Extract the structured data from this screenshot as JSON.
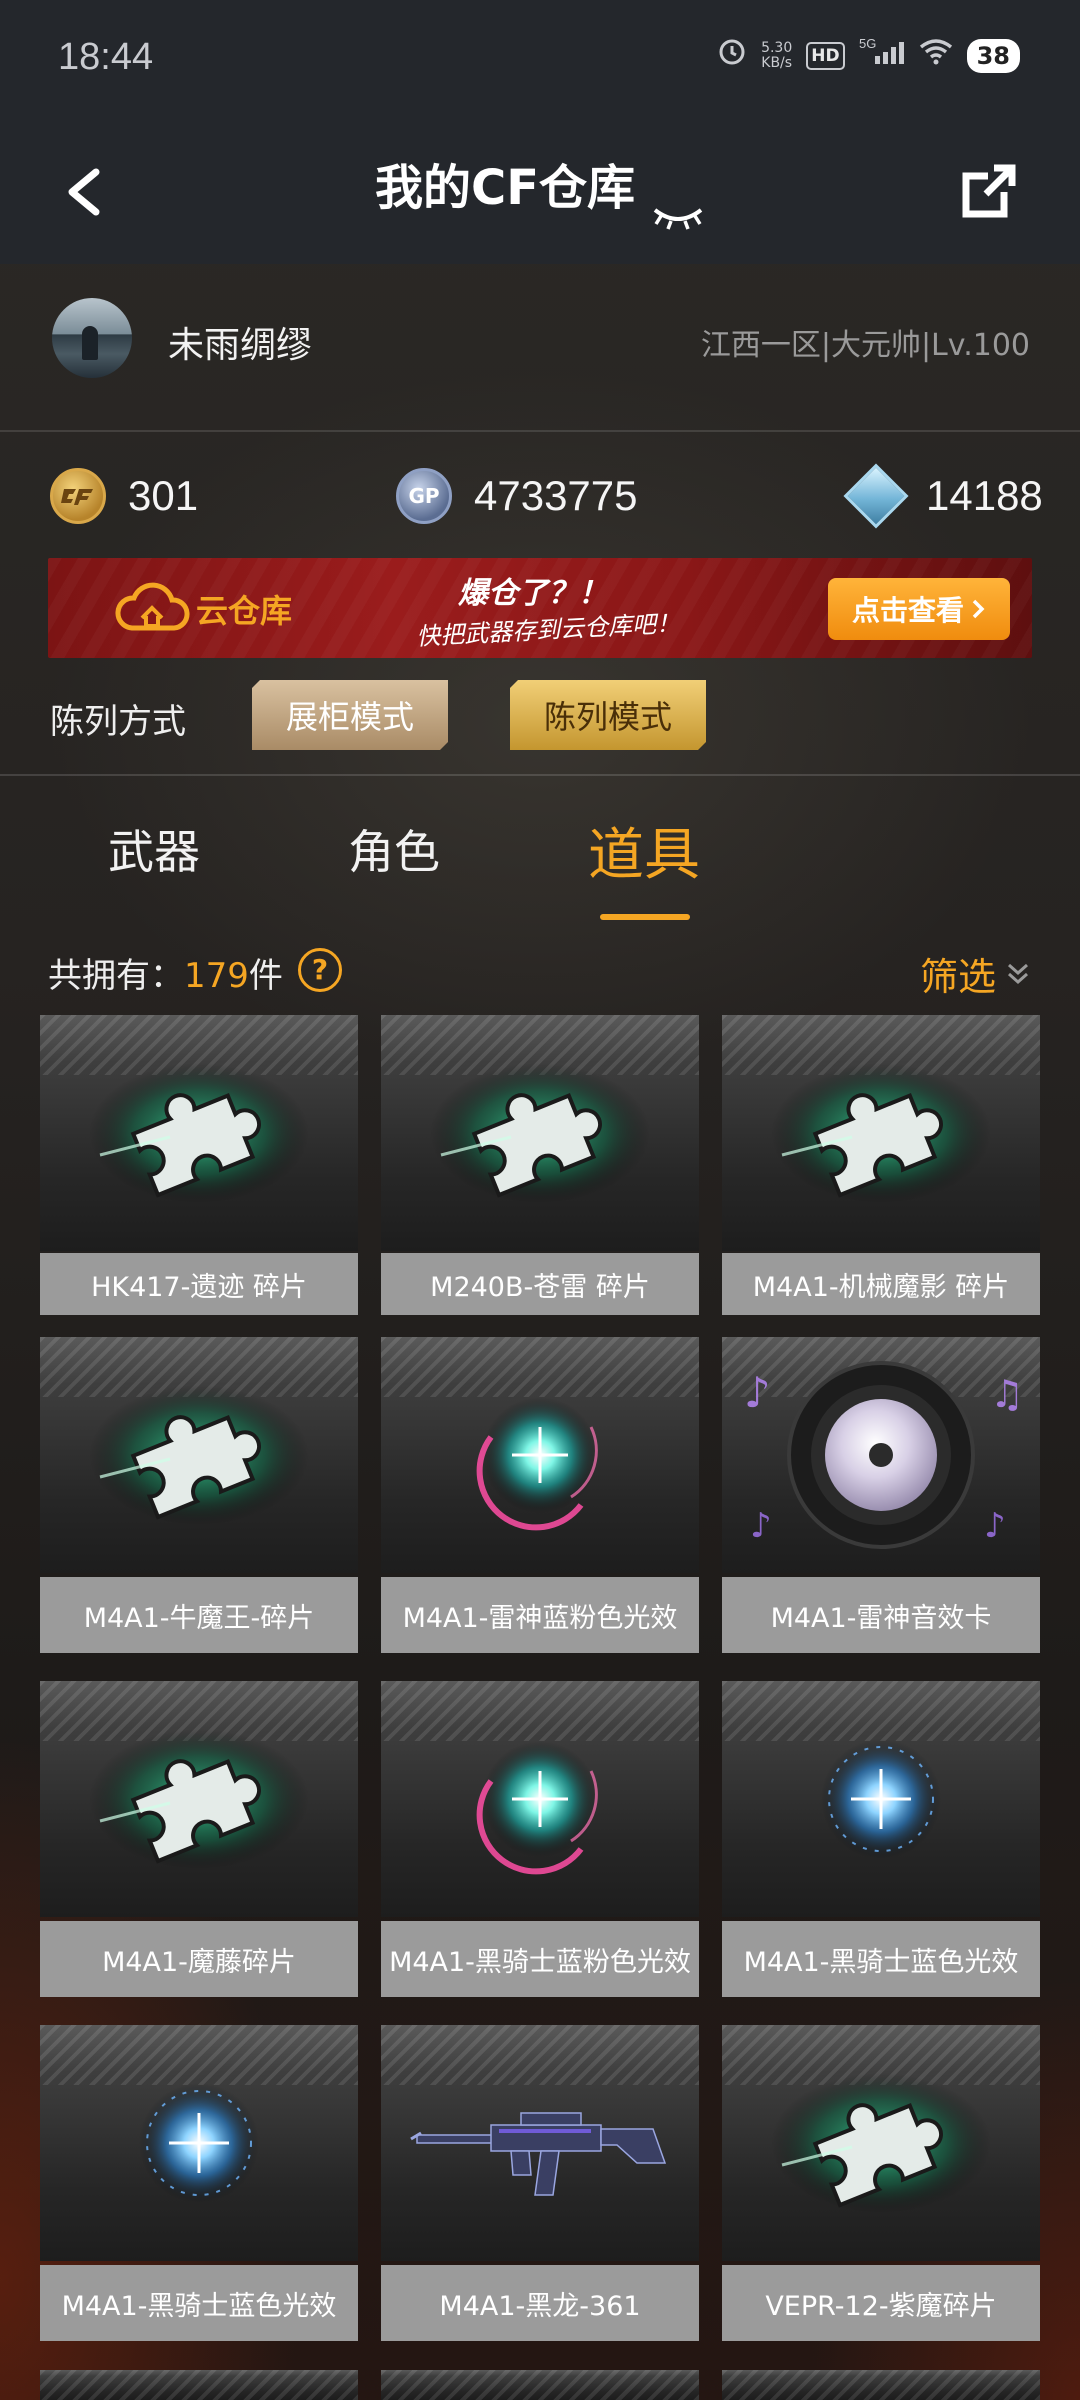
{
  "status": {
    "time": "18:44",
    "speed": "5.30\nKB/s",
    "network": "5G",
    "battery": "38"
  },
  "header": {
    "title": "我的CF仓库"
  },
  "profile": {
    "name": "未雨绸缪",
    "server": "江西一区|大元帅|Lv.100"
  },
  "currency": {
    "cf": "301",
    "gp": "4733775",
    "diamond": "14188",
    "gp_label": "GP"
  },
  "banner": {
    "brand": "云仓库",
    "line1": "爆仓了？！",
    "line2": "快把武器存到云仓库吧！",
    "button": "点击查看"
  },
  "display_mode": {
    "label": "陈列方式",
    "options": [
      "展柜模式",
      "陈列模式"
    ],
    "selected": "陈列模式"
  },
  "tabs": [
    {
      "label": "武器",
      "active": false
    },
    {
      "label": "角色",
      "active": false
    },
    {
      "label": "道具",
      "active": true
    }
  ],
  "count": {
    "prefix": "共拥有：",
    "number": "179",
    "suffix": "件",
    "help": "?"
  },
  "filter": {
    "label": "筛选"
  },
  "items": [
    {
      "name": "HK417-遗迹 碎片",
      "icon": "puzzle"
    },
    {
      "name": "M240B-苍雷 碎片",
      "icon": "puzzle"
    },
    {
      "name": "M4A1-机械魔影 碎片",
      "icon": "puzzle"
    },
    {
      "name": "M4A1-牛魔王-碎片",
      "icon": "puzzle"
    },
    {
      "name": "M4A1-雷神蓝粉色光效",
      "icon": "glow-pink"
    },
    {
      "name": "M4A1-雷神音效卡",
      "icon": "music-disc"
    },
    {
      "name": "M4A1-魔藤碎片",
      "icon": "puzzle"
    },
    {
      "name": "M4A1-黑骑士蓝粉色光效",
      "icon": "glow-pink"
    },
    {
      "name": "M4A1-黑骑士蓝色光效",
      "icon": "glow-blue"
    },
    {
      "name": "M4A1-黑骑士蓝色光效",
      "icon": "glow-blue"
    },
    {
      "name": "M4A1-黑龙-361",
      "icon": "rifle"
    },
    {
      "name": "VEPR-12-紫魔碎片",
      "icon": "puzzle"
    }
  ],
  "colors": {
    "accent": "#f5a623",
    "header_bg": "#24272c",
    "label_bg": "#9b9b9b"
  }
}
